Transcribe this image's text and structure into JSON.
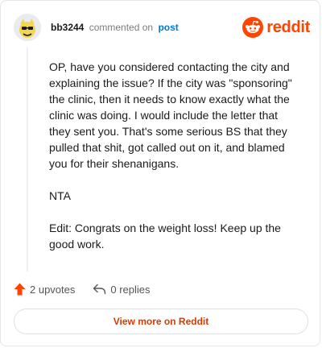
{
  "header": {
    "username": "bb3244",
    "action_text": "commented on",
    "post_link": "post",
    "brand": "reddit"
  },
  "comment": {
    "paragraphs": [
      "OP, have you considered contacting the city and explaining the issue? If the city was \"sponsoring\" the clinic, then it needs to know exactly what the clinic was doing. I would include the letter that they sent you. That's some serious BS that they pulled that shit, got called out on it, and blamed you for their shenanigans.",
      "NTA",
      "Edit: Congrats on the weight loss! Keep up the good work."
    ]
  },
  "actions": {
    "upvotes_label": "2 upvotes",
    "replies_label": "0 replies"
  },
  "cta": {
    "label": "View more on Reddit"
  },
  "colors": {
    "brand": "#ff4500",
    "link": "#0079d3",
    "cta": "#d93a00"
  },
  "icons": [
    "avatar-icon",
    "reddit-alien-icon",
    "upvote-arrow-icon",
    "reply-arrow-icon"
  ]
}
